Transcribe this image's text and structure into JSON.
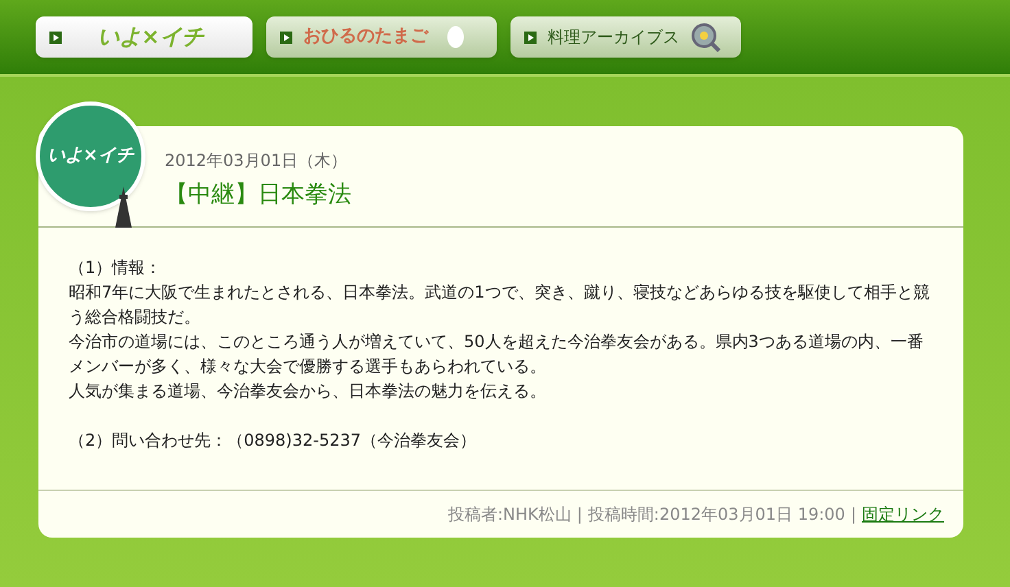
{
  "nav_tabs": [
    {
      "label": "いよ×イチ",
      "selected": true,
      "kind": "logo"
    },
    {
      "label": "おひるのたまご",
      "selected": false,
      "kind": "egg"
    },
    {
      "label": "料理アーカイブス",
      "selected": false,
      "kind": "search"
    }
  ],
  "post": {
    "logo": "いよ×イチ",
    "date": "2012年03月01日（木）",
    "title": "【中継】日本拳法",
    "paragraphs": [
      "（1）情報：",
      "昭和7年に大阪で生まれたとされる、日本拳法。武道の1つで、突き、蹴り、寝技などあらゆる技を駆使して相手と競う総合格闘技だ。",
      "今治市の道場には、このところ通う人が増えていて、50人を超えた今治拳友会がある。県内3つある道場の内、一番メンバーが多く、様々な大会で優勝する選手もあらわれている。",
      "人気が集まる道場、今治拳友会から、日本拳法の魅力を伝える。"
    ],
    "contact": "（2）問い合わせ先：（0898)32-5237（今治拳友会）",
    "footer": {
      "author": "投稿者:NHK松山",
      "separator_1": "|",
      "posted_time": "投稿時間:2012年03月01日 19:00",
      "separator_2": "|",
      "permalink": "固定リンク"
    }
  }
}
